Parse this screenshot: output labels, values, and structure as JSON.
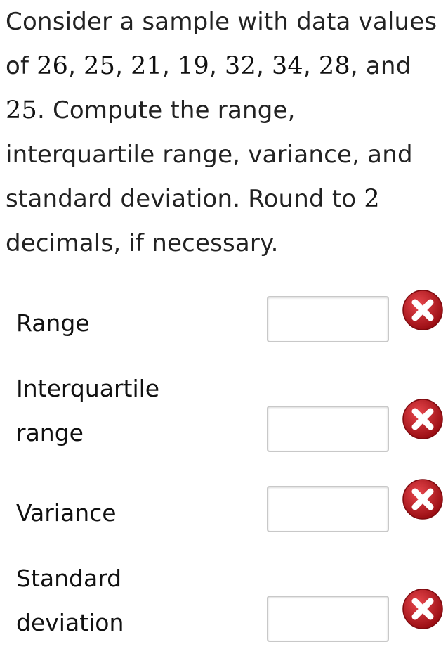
{
  "question": {
    "t1": "Consider a sample with data values of ",
    "values": [
      "26",
      "25",
      "21",
      "19",
      "32",
      "34",
      "28",
      "25"
    ],
    "sep": ", ",
    "and": ", and ",
    "t2": ". Compute the range, interquartile range, variance, and standard deviation. Round to ",
    "decimals": "2",
    "t3": " decimals, if necessary."
  },
  "fields": [
    {
      "label_line1": "Range",
      "label_line2": "",
      "value": "",
      "status": "incorrect"
    },
    {
      "label_line1": "Interquartile",
      "label_line2": "range",
      "value": "",
      "status": "incorrect"
    },
    {
      "label_line1": "Variance",
      "label_line2": "",
      "value": "",
      "status": "incorrect"
    },
    {
      "label_line1": "Standard",
      "label_line2": "deviation",
      "value": "",
      "status": "incorrect"
    }
  ],
  "colors": {
    "incorrect_icon": "#c0141c",
    "input_border": "#c8c8c8"
  },
  "icons": {
    "incorrect": "x-circle-icon"
  }
}
